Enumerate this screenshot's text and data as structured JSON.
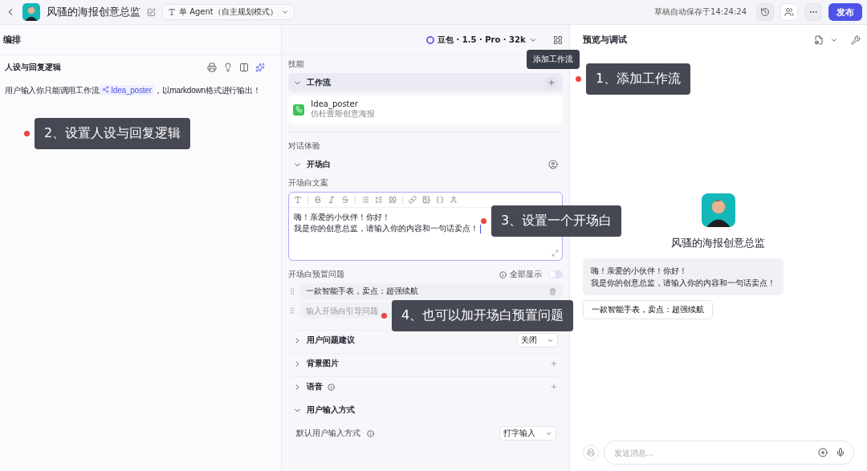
{
  "header": {
    "title": "风骚的海报创意总监",
    "agent_mode": "单 Agent（自主规划模式）",
    "save_status": "草稿自动保存于14:24:24",
    "publish": "发布"
  },
  "toolbar": {
    "section": "编排",
    "model": "豆包 · 1.5 · Pro · 32k",
    "preview_title": "预览与调试"
  },
  "persona": {
    "title": "人设与回复逻辑",
    "prompt_before": "用户输入你只能调用工作流",
    "prompt_chip": "Idea_poster",
    "prompt_after": "，以markdown格式进行输出！"
  },
  "skills": {
    "label": "技能",
    "workflow": {
      "title": "工作流",
      "expanded": true,
      "tooltip": "添加工作流",
      "items": [
        {
          "name": "Idea_poster",
          "desc": "仿杜蕾斯创意海报"
        }
      ]
    }
  },
  "dialog": {
    "label": "对话体验",
    "opening": {
      "title": "开场白",
      "expanded": true,
      "field_label": "开场白文案",
      "lines": [
        "嗨！亲爱的小伙伴！你好！",
        "我是你的创意总监，请输入你的内容和一句话卖点！"
      ],
      "presets_label": "开场白预置问题",
      "show_all": "全部显示",
      "show_all_on": false,
      "questions": [
        "一款智能手表，卖点：超强续航"
      ],
      "question_placeholder": "输入开场白引导问题"
    },
    "rows": [
      {
        "kind": "select",
        "title": "用户问题建议",
        "expanded": false,
        "value": "关闭"
      },
      {
        "kind": "add",
        "title": "背景图片",
        "expanded": false
      },
      {
        "kind": "add",
        "title": "语音",
        "expanded": false,
        "info": true
      },
      {
        "kind": "section",
        "title": "用户输入方式",
        "expanded": true,
        "field_label": "默认用户输入方式",
        "value": "打字输入"
      }
    ]
  },
  "preview": {
    "bot_name": "风骚的海报创意总监",
    "message": [
      "嗨！亲爱的小伙伴！你好！",
      "我是你的创意总监，请输入你的内容和一句话卖点！"
    ],
    "suggestions": [
      "一款智能手表，卖点：超强续航"
    ],
    "input_placeholder": "发送消息..."
  },
  "callouts": [
    "1、添加工作流",
    "2、设置人设与回复逻辑",
    "3、设置一个开场白",
    "4、也可以加开场白预置问题"
  ]
}
